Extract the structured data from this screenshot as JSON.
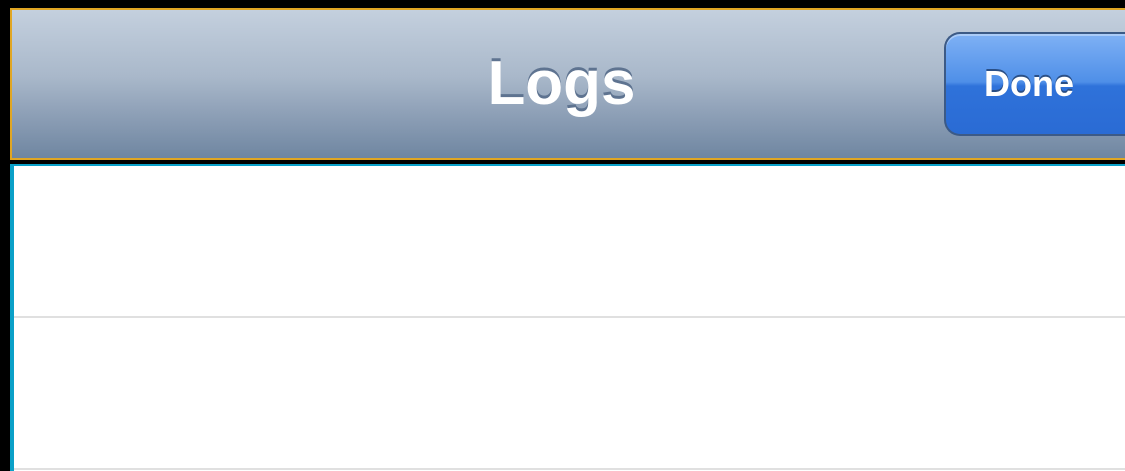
{
  "navbar": {
    "title": "Logs",
    "done_label": "Done"
  },
  "table": {
    "rows": [
      {
        "label": ""
      },
      {
        "label": ""
      }
    ]
  },
  "colors": {
    "navbar_gradient_top": "#c4d0de",
    "navbar_gradient_bottom": "#6f86a1",
    "done_button_blue": "#2f72da",
    "table_background": "#ffffff"
  }
}
